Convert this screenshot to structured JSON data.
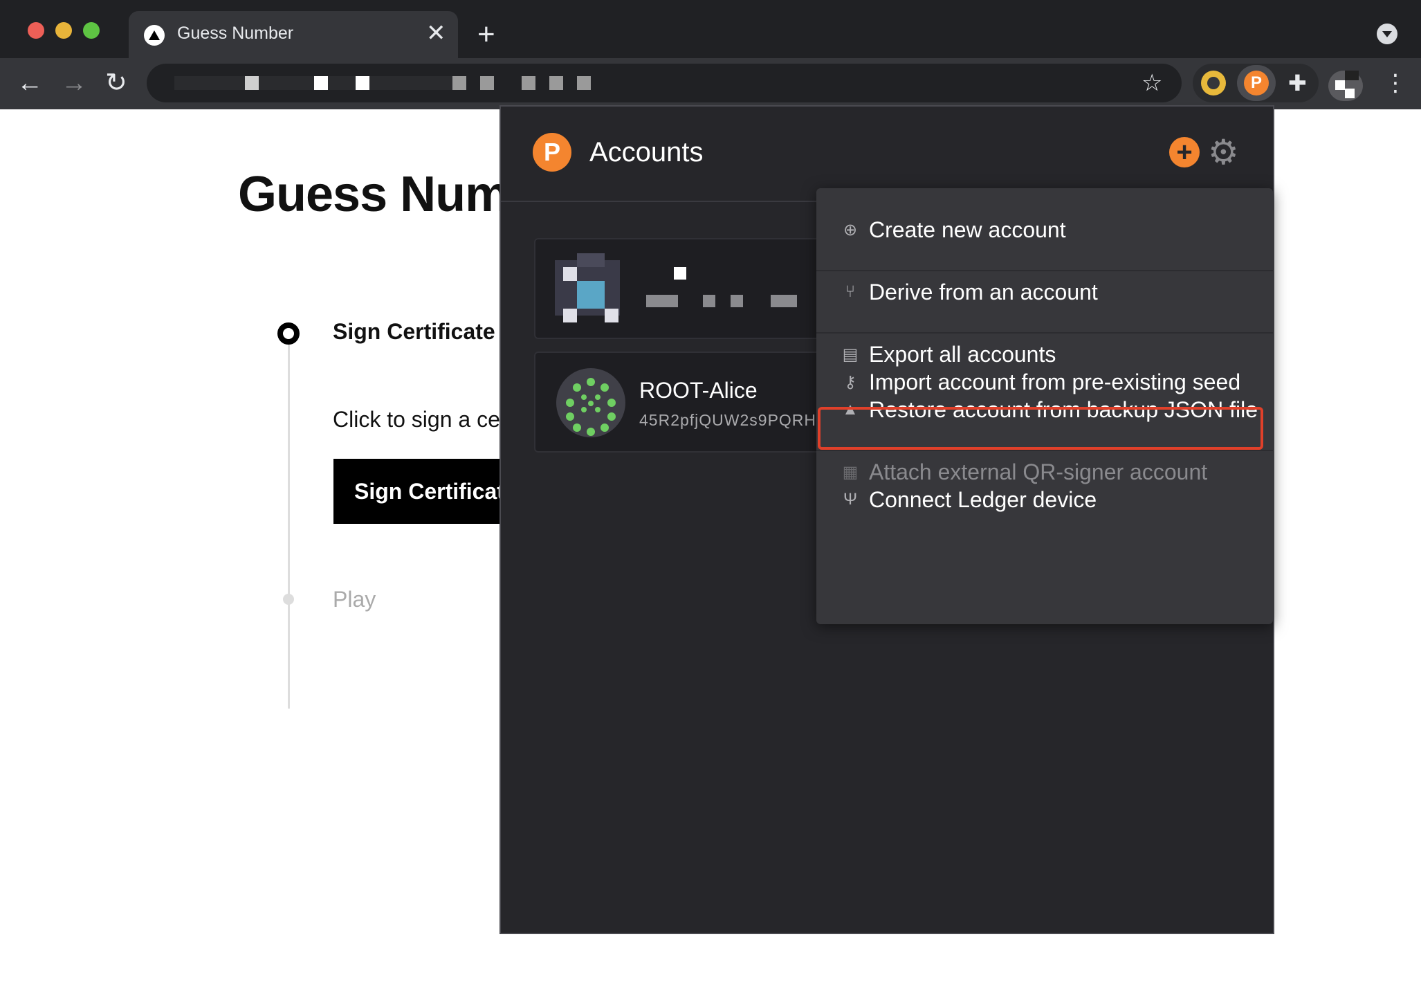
{
  "browser": {
    "tab_title": "Guess Number",
    "tab_close": "✕",
    "new_tab": "+",
    "back": "←",
    "forward": "→",
    "reload": "↻",
    "star": "☆",
    "puzzle": "✚",
    "menu": "⋮"
  },
  "page": {
    "title": "Guess Numb",
    "step1_label": "Sign Certificate",
    "step1_desc": "Click to sign a ce",
    "sign_button": "Sign Certificat",
    "step2_label": "Play"
  },
  "popup": {
    "logo": "P",
    "title": "Accounts",
    "add": "+",
    "settings": "⚙",
    "accounts": [
      {
        "name": "ROOT-Alice",
        "address": "45R2pfjQUW2s9PQRH"
      }
    ]
  },
  "menu": {
    "items": [
      {
        "label": "Create new account",
        "icon": "plus-circle-icon",
        "glyph": "⊕",
        "enabled": true
      },
      {
        "label": "Derive from an account",
        "icon": "branch-icon",
        "glyph": "⑂",
        "enabled": true
      },
      {
        "label": "Export all accounts",
        "icon": "file-export-icon",
        "glyph": "▤",
        "enabled": true
      },
      {
        "label": "Import account from pre-existing seed",
        "icon": "key-icon",
        "glyph": "⚷",
        "enabled": true
      },
      {
        "label": "Restore account from backup JSON file",
        "icon": "file-upload-icon",
        "glyph": "▲",
        "enabled": true
      },
      {
        "label": "Attach external QR-signer account",
        "icon": "qrcode-icon",
        "glyph": "▦",
        "enabled": false
      },
      {
        "label": "Connect Ledger device",
        "icon": "usb-icon",
        "glyph": "Ψ",
        "enabled": true
      }
    ],
    "highlighted_item": "Import account from pre-existing seed"
  },
  "colors": {
    "accent": "#f4852f",
    "highlight": "#e0402a",
    "identicon_green": "#6fcf62"
  }
}
